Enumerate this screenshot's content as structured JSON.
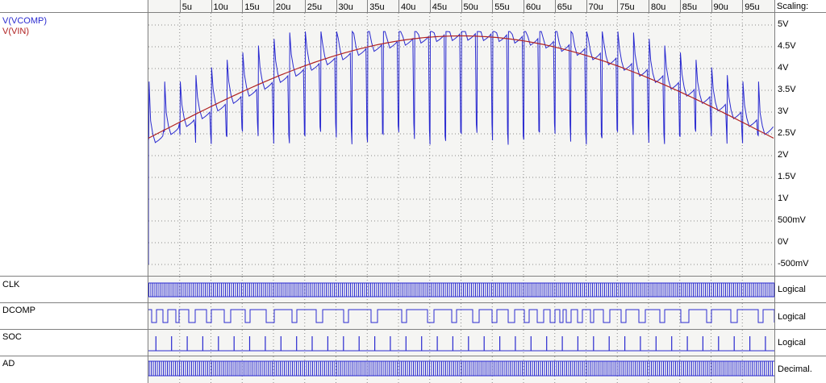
{
  "time_axis": {
    "ticks": [
      "5u",
      "10u",
      "15u",
      "20u",
      "25u",
      "30u",
      "35u",
      "40u",
      "45u",
      "50u",
      "55u",
      "60u",
      "65u",
      "70u",
      "75u",
      "80u",
      "85u",
      "90u",
      "95u"
    ],
    "scaling_label": "Scaling:"
  },
  "analog": {
    "traces": [
      {
        "name": "V(VCOMP)",
        "color": "#2a2ad0"
      },
      {
        "name": "V(VIN)",
        "color": "#b02020"
      }
    ],
    "y_labels": [
      "5V",
      "4.5V",
      "4V",
      "3.5V",
      "3V",
      "2.5V",
      "2V",
      "1.5V",
      "1V",
      "500mV",
      "0V",
      "-500mV"
    ]
  },
  "digital": [
    {
      "name": "CLK",
      "scaling": "Logical"
    },
    {
      "name": "DCOMP",
      "scaling": "Logical"
    },
    {
      "name": "SOC",
      "scaling": "Logical"
    },
    {
      "name": "AD",
      "scaling": "Decimal."
    }
  ],
  "colors": {
    "trace_blue": "#2a2ad0",
    "trace_red": "#b02020",
    "grid": "#808080"
  }
}
